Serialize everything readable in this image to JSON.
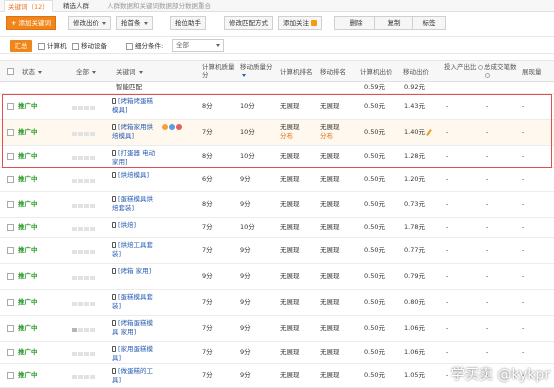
{
  "tabs": [
    {
      "label": "关键词（12）"
    },
    {
      "label": "精选人群"
    },
    {
      "label": "人群数据和关键词数据部分数据重合"
    }
  ],
  "toolbar": {
    "add_keyword": "添加关键词",
    "modify_bid": "修改出价",
    "grab_first": "抢首条",
    "grab_assistant": "抢位助手",
    "modify_match": "修改匹配方式",
    "add_follow": "添加关注",
    "delete": "删除",
    "copy": "复制",
    "tag": "标签"
  },
  "filters": {
    "summary": "汇总",
    "computer": "计算机",
    "mobile": "移动设备",
    "subdivide": "细分条件:",
    "all": "全部"
  },
  "headers": {
    "status": "状态",
    "all": "全部",
    "keyword": "关键词",
    "pc_quality": "计算机质量分",
    "mobile_quality": "移动质量分",
    "pc_rank": "计算机排名",
    "mobile_rank": "移动排名",
    "pc_bid": "计算机出价",
    "mobile_bid": "移动出价",
    "roi": "投入产出比",
    "total_deals": "总成交笔数",
    "impressions": "展现量"
  },
  "summary_row": {
    "match": "智能匹配",
    "pc_bid": "0.59元",
    "mobile_bid": "0.92元"
  },
  "rows": [
    {
      "status": "推广中",
      "keyword": "[烤箱烤蛋糕模具]",
      "pcq": "8分",
      "mq": "10分",
      "pcr": "无展现",
      "mr": "无展现",
      "pcb": "0.50元",
      "mb": "1.43元",
      "roi": "-",
      "deals": "-",
      "imp": "-"
    },
    {
      "status": "推广中",
      "keyword": "[烤箱家用烘焙模具]",
      "pcq": "7分",
      "mq": "10分",
      "pcr": "无展现",
      "pcr2": "分布",
      "mr": "无展现",
      "mr2": "分布",
      "pcb": "0.50元",
      "mb": "1.40元",
      "roi": "-",
      "deals": "-",
      "imp": "-"
    },
    {
      "status": "推广中",
      "keyword": "[打蛋器 电动 家用]",
      "pcq": "8分",
      "mq": "10分",
      "pcr": "无展现",
      "mr": "无展现",
      "pcb": "0.50元",
      "mb": "1.28元",
      "roi": "-",
      "deals": "-",
      "imp": "-"
    },
    {
      "status": "推广中",
      "keyword": "[烘焙模具]",
      "pcq": "6分",
      "mq": "9分",
      "pcr": "无展现",
      "mr": "无展现",
      "pcb": "0.50元",
      "mb": "1.20元",
      "roi": "-",
      "deals": "-",
      "imp": "-"
    },
    {
      "status": "推广中",
      "keyword": "[蛋糕模具烘焙套装]",
      "pcq": "8分",
      "mq": "9分",
      "pcr": "无展现",
      "mr": "无展现",
      "pcb": "0.50元",
      "mb": "0.73元",
      "roi": "-",
      "deals": "-",
      "imp": "-"
    },
    {
      "status": "推广中",
      "keyword": "[烘焙]",
      "pcq": "7分",
      "mq": "10分",
      "pcr": "无展现",
      "mr": "无展现",
      "pcb": "0.50元",
      "mb": "1.78元",
      "roi": "-",
      "deals": "-",
      "imp": "-"
    },
    {
      "status": "推广中",
      "keyword": "[烘焙工具套装]",
      "pcq": "7分",
      "mq": "9分",
      "pcr": "无展现",
      "mr": "无展现",
      "pcb": "0.50元",
      "mb": "0.77元",
      "roi": "-",
      "deals": "-",
      "imp": "-"
    },
    {
      "status": "推广中",
      "keyword": "[烤箱 家用]",
      "pcq": "9分",
      "mq": "9分",
      "pcr": "无展现",
      "mr": "无展现",
      "pcb": "0.50元",
      "mb": "0.79元",
      "roi": "-",
      "deals": "-",
      "imp": "-"
    },
    {
      "status": "推广中",
      "keyword": "[蛋糕模具套装]",
      "pcq": "7分",
      "mq": "9分",
      "pcr": "无展现",
      "mr": "无展现",
      "pcb": "0.50元",
      "mb": "0.80元",
      "roi": "-",
      "deals": "-",
      "imp": "-"
    },
    {
      "status": "推广中",
      "keyword": "[烤箱蛋糕模具 家用]",
      "pcq": "7分",
      "mq": "9分",
      "pcr": "无展现",
      "mr": "无展现",
      "pcb": "0.50元",
      "mb": "1.06元",
      "roi": "-",
      "deals": "-",
      "imp": "-"
    },
    {
      "status": "推广中",
      "keyword": "[家用蛋糕模具]",
      "pcq": "7分",
      "mq": "9分",
      "pcr": "无展现",
      "mr": "无展现",
      "pcb": "0.50元",
      "mb": "1.06元",
      "roi": "-",
      "deals": "-",
      "imp": "-"
    },
    {
      "status": "推广中",
      "keyword": "[做蛋糕的工具]",
      "pcq": "7分",
      "mq": "9分",
      "pcr": "无展现",
      "mr": "无展现",
      "pcb": "0.50元",
      "mb": "1.05元",
      "roi": "-",
      "deals": "-",
      "imp": "-"
    }
  ],
  "watermark": "学买卖 @kykpr",
  "colors": {
    "accent": "#f08519",
    "status_green": "#2a9a2a",
    "link_blue": "#2b5fb4",
    "highlight_red": "#e05050"
  }
}
